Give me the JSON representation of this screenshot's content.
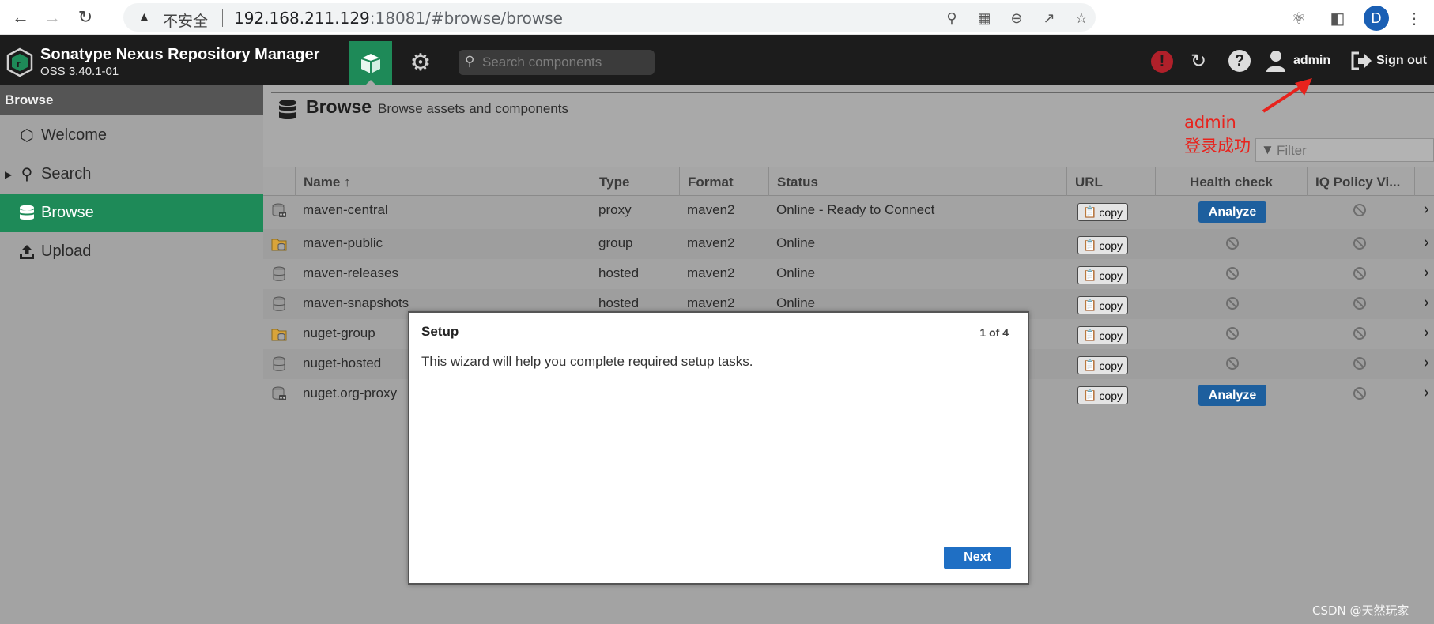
{
  "browser": {
    "security_label": "不安全",
    "url_host": "192.168.211.129",
    "url_rest": ":18081/#browse/browse",
    "profile_initial": "D"
  },
  "header": {
    "app_title": "Sonatype Nexus Repository Manager",
    "app_version": "OSS 3.40.1-01",
    "search_placeholder": "Search components",
    "user_label": "admin",
    "signout_label": "Sign out",
    "alert_glyph": "!",
    "help_glyph": "?"
  },
  "sidebar": {
    "title": "Browse",
    "items": [
      {
        "label": "Welcome",
        "icon": "hexagon-icon"
      },
      {
        "label": "Search",
        "icon": "search-icon"
      },
      {
        "label": "Browse",
        "icon": "database-icon",
        "active": true
      },
      {
        "label": "Upload",
        "icon": "upload-icon"
      }
    ]
  },
  "page": {
    "title": "Browse",
    "subtitle": "Browse assets and components",
    "filter_placeholder": "Filter"
  },
  "annotation": {
    "line1": "admin",
    "line2": "登录成功"
  },
  "grid": {
    "columns": [
      "Name ↑",
      "Type",
      "Format",
      "Status",
      "URL",
      "Health check",
      "IQ Policy Vi..."
    ],
    "copy_label": "copy",
    "analyze_label": "Analyze",
    "rows": [
      {
        "name": "maven-central",
        "type": "proxy",
        "format": "maven2",
        "status": "Online - Ready to Connect",
        "kind": "proxy",
        "health": "analyze"
      },
      {
        "name": "maven-public",
        "type": "group",
        "format": "maven2",
        "status": "Online",
        "kind": "group",
        "health": "none"
      },
      {
        "name": "maven-releases",
        "type": "hosted",
        "format": "maven2",
        "status": "Online",
        "kind": "hosted",
        "health": "none"
      },
      {
        "name": "maven-snapshots",
        "type": "hosted",
        "format": "maven2",
        "status": "Online",
        "kind": "hosted",
        "health": "none"
      },
      {
        "name": "nuget-group",
        "type": "",
        "format": "",
        "status": "",
        "kind": "group",
        "health": "none"
      },
      {
        "name": "nuget-hosted",
        "type": "",
        "format": "",
        "status": "",
        "kind": "hosted",
        "health": "none"
      },
      {
        "name": "nuget.org-proxy",
        "type": "",
        "format": "",
        "status": "",
        "kind": "proxy",
        "health": "analyze"
      }
    ]
  },
  "modal": {
    "title": "Setup",
    "step": "1 of 4",
    "text": "This wizard will help you complete required setup tasks.",
    "next_label": "Next"
  },
  "watermark": "CSDN @天然玩家",
  "colors": {
    "accent_green": "#1e8a58",
    "header_bg": "#1c1c1c",
    "analyze_blue": "#1d5f9e",
    "next_blue": "#1f6fc4",
    "annotation_red": "#e8231d"
  }
}
